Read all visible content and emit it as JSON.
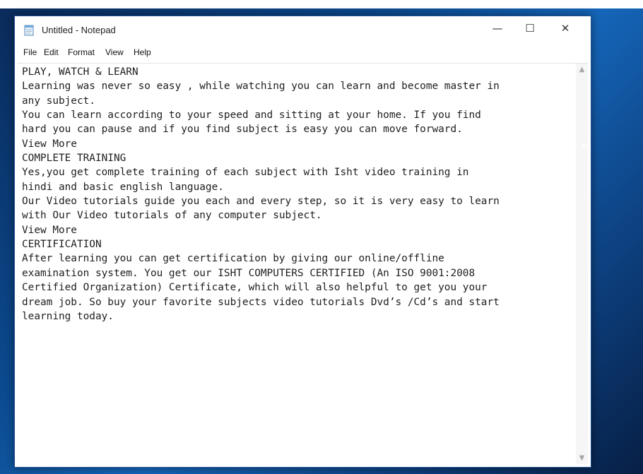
{
  "window": {
    "title": "Untitled - Notepad",
    "minimize_glyph": "—",
    "maximize_glyph": "☐",
    "close_glyph": "✕"
  },
  "menu": {
    "items": [
      {
        "label": "File"
      },
      {
        "label": "Edit"
      },
      {
        "label": "Format"
      },
      {
        "label": "View"
      },
      {
        "label": "Help"
      }
    ]
  },
  "editor": {
    "lines": [
      "PLAY, WATCH & LEARN",
      "Learning was never so easy , while watching you can learn and become master in",
      "any subject.",
      "You can learn according to your speed and sitting at your home. If you find",
      "hard you can pause and if you find subject is easy you can move forward.",
      "View More",
      "COMPLETE TRAINING",
      "Yes,you get complete training of each subject with Isht video training in",
      "hindi and basic english language.",
      "Our Video tutorials guide you each and every step, so it is very easy to learn",
      "with Our Video tutorials of any computer subject.",
      "View More",
      "CERTIFICATION",
      "After learning you can get certification by giving our online/offline",
      "examination system. You get our ISHT COMPUTERS CERTIFIED (An ISO 9001:2008",
      "Certified Organization) Certificate, which will also helpful to get you your",
      "dream job. So buy your favorite subjects video tutorials Dvd’s /Cd’s and start",
      "learning today."
    ]
  },
  "scrollbar": {
    "up_glyph": "▲",
    "down_glyph": "▼"
  },
  "cursor": {
    "glyph": "⇔"
  },
  "colors": {
    "desktop_accent": "#0b4a8f",
    "window_border": "#1e4f8f",
    "text": "#1e1e1e"
  }
}
